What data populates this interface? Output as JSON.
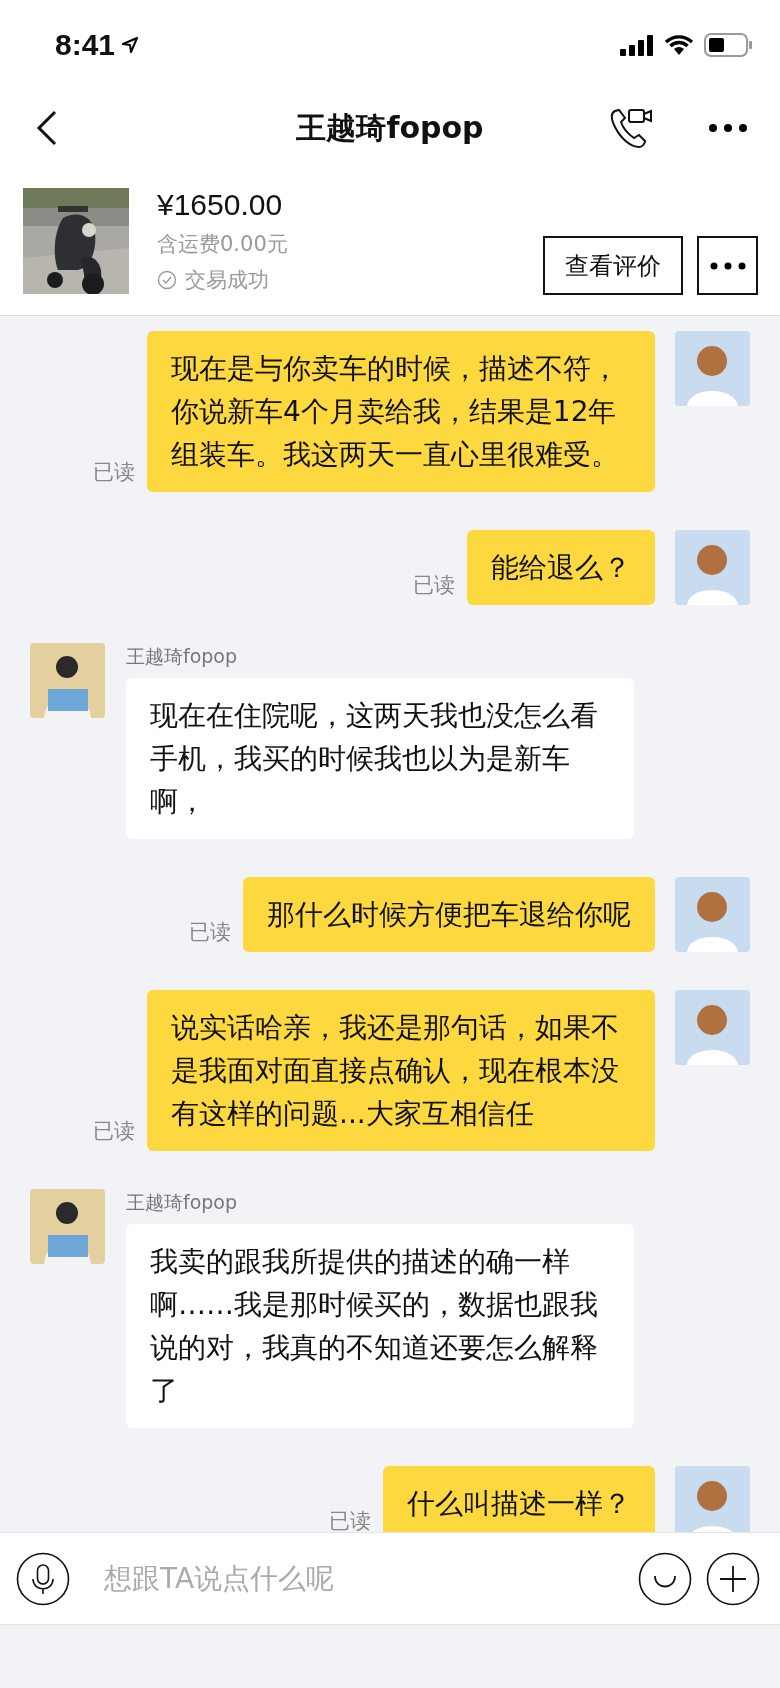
{
  "status_bar": {
    "time": "8:41"
  },
  "header": {
    "title": "王越琦fopop"
  },
  "product": {
    "price": "¥1650.00",
    "shipping": "含运费0.00元",
    "status": "交易成功",
    "review_button": "查看评价"
  },
  "messages": [
    {
      "kind": "out",
      "text": "现在是与你卖车的时候，描述不符，你说新车4个月卖给我，结果是12年组装车。我这两天一直心里很难受。",
      "read": "已读"
    },
    {
      "kind": "out",
      "text": "能给退么？",
      "read": "已读"
    },
    {
      "kind": "in",
      "sender": "王越琦fopop",
      "text": "现在在住院呢，这两天我也没怎么看手机，我买的时候我也以为是新车啊，"
    },
    {
      "kind": "out",
      "text": "那什么时候方便把车退给你呢",
      "read": "已读"
    },
    {
      "kind": "out",
      "text": "说实话哈亲，我还是那句话，如果不是我面对面直接点确认，现在根本没有这样的问题...大家互相信任",
      "read": "已读"
    },
    {
      "kind": "in",
      "sender": "王越琦fopop",
      "text": "我卖的跟我所提供的描述的确一样啊……我是那时候买的，数据也跟我说的对，我真的不知道还要怎么解释了"
    },
    {
      "kind": "out",
      "text": "什么叫描述一样？",
      "read": "已读"
    }
  ],
  "input": {
    "placeholder": "想跟TA说点什么呢"
  }
}
